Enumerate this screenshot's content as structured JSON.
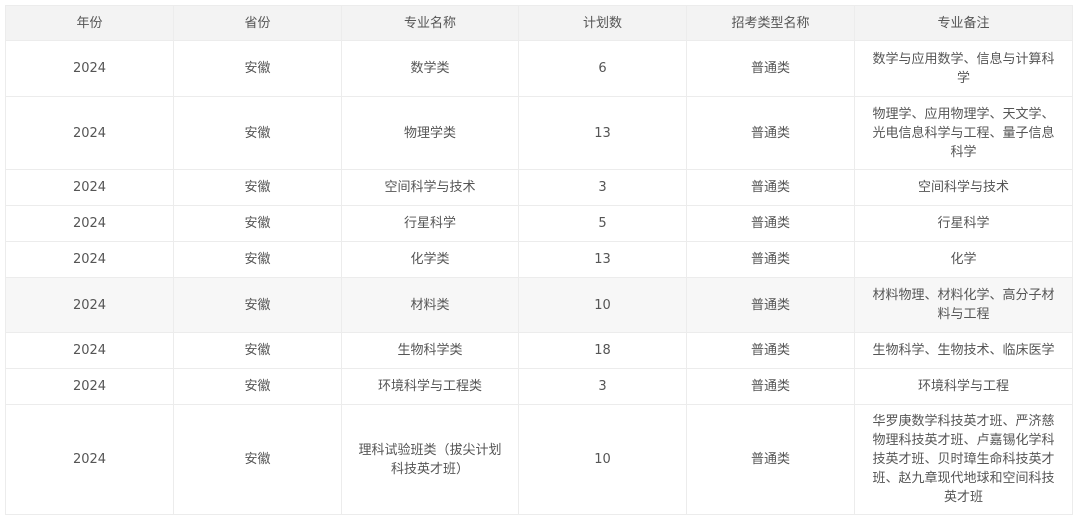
{
  "table": {
    "headers": [
      "年份",
      "省份",
      "专业名称",
      "计划数",
      "招考类型名称",
      "专业备注"
    ],
    "rows": [
      {
        "year": "2024",
        "province": "安徽",
        "major": "数学类",
        "plan": "6",
        "type": "普通类",
        "note": "数学与应用数学、信息与计算科学"
      },
      {
        "year": "2024",
        "province": "安徽",
        "major": "物理学类",
        "plan": "13",
        "type": "普通类",
        "note": "物理学、应用物理学、天文学、光电信息科学与工程、量子信息科学"
      },
      {
        "year": "2024",
        "province": "安徽",
        "major": "空间科学与技术",
        "plan": "3",
        "type": "普通类",
        "note": "空间科学与技术"
      },
      {
        "year": "2024",
        "province": "安徽",
        "major": "行星科学",
        "plan": "5",
        "type": "普通类",
        "note": "行星科学"
      },
      {
        "year": "2024",
        "province": "安徽",
        "major": "化学类",
        "plan": "13",
        "type": "普通类",
        "note": "化学"
      },
      {
        "year": "2024",
        "province": "安徽",
        "major": "材料类",
        "plan": "10",
        "type": "普通类",
        "note": "材料物理、材料化学、高分子材料与工程"
      },
      {
        "year": "2024",
        "province": "安徽",
        "major": "生物科学类",
        "plan": "18",
        "type": "普通类",
        "note": "生物科学、生物技术、临床医学"
      },
      {
        "year": "2024",
        "province": "安徽",
        "major": "环境科学与工程类",
        "plan": "3",
        "type": "普通类",
        "note": "环境科学与工程"
      },
      {
        "year": "2024",
        "province": "安徽",
        "major": "理科试验班类（拔尖计划科技英才班）",
        "plan": "10",
        "type": "普通类",
        "note": "华罗庚数学科技英才班、严济慈物理科技英才班、卢嘉锡化学科技英才班、贝时璋生命科技英才班、赵九章现代地球和空间科技英才班"
      }
    ]
  }
}
